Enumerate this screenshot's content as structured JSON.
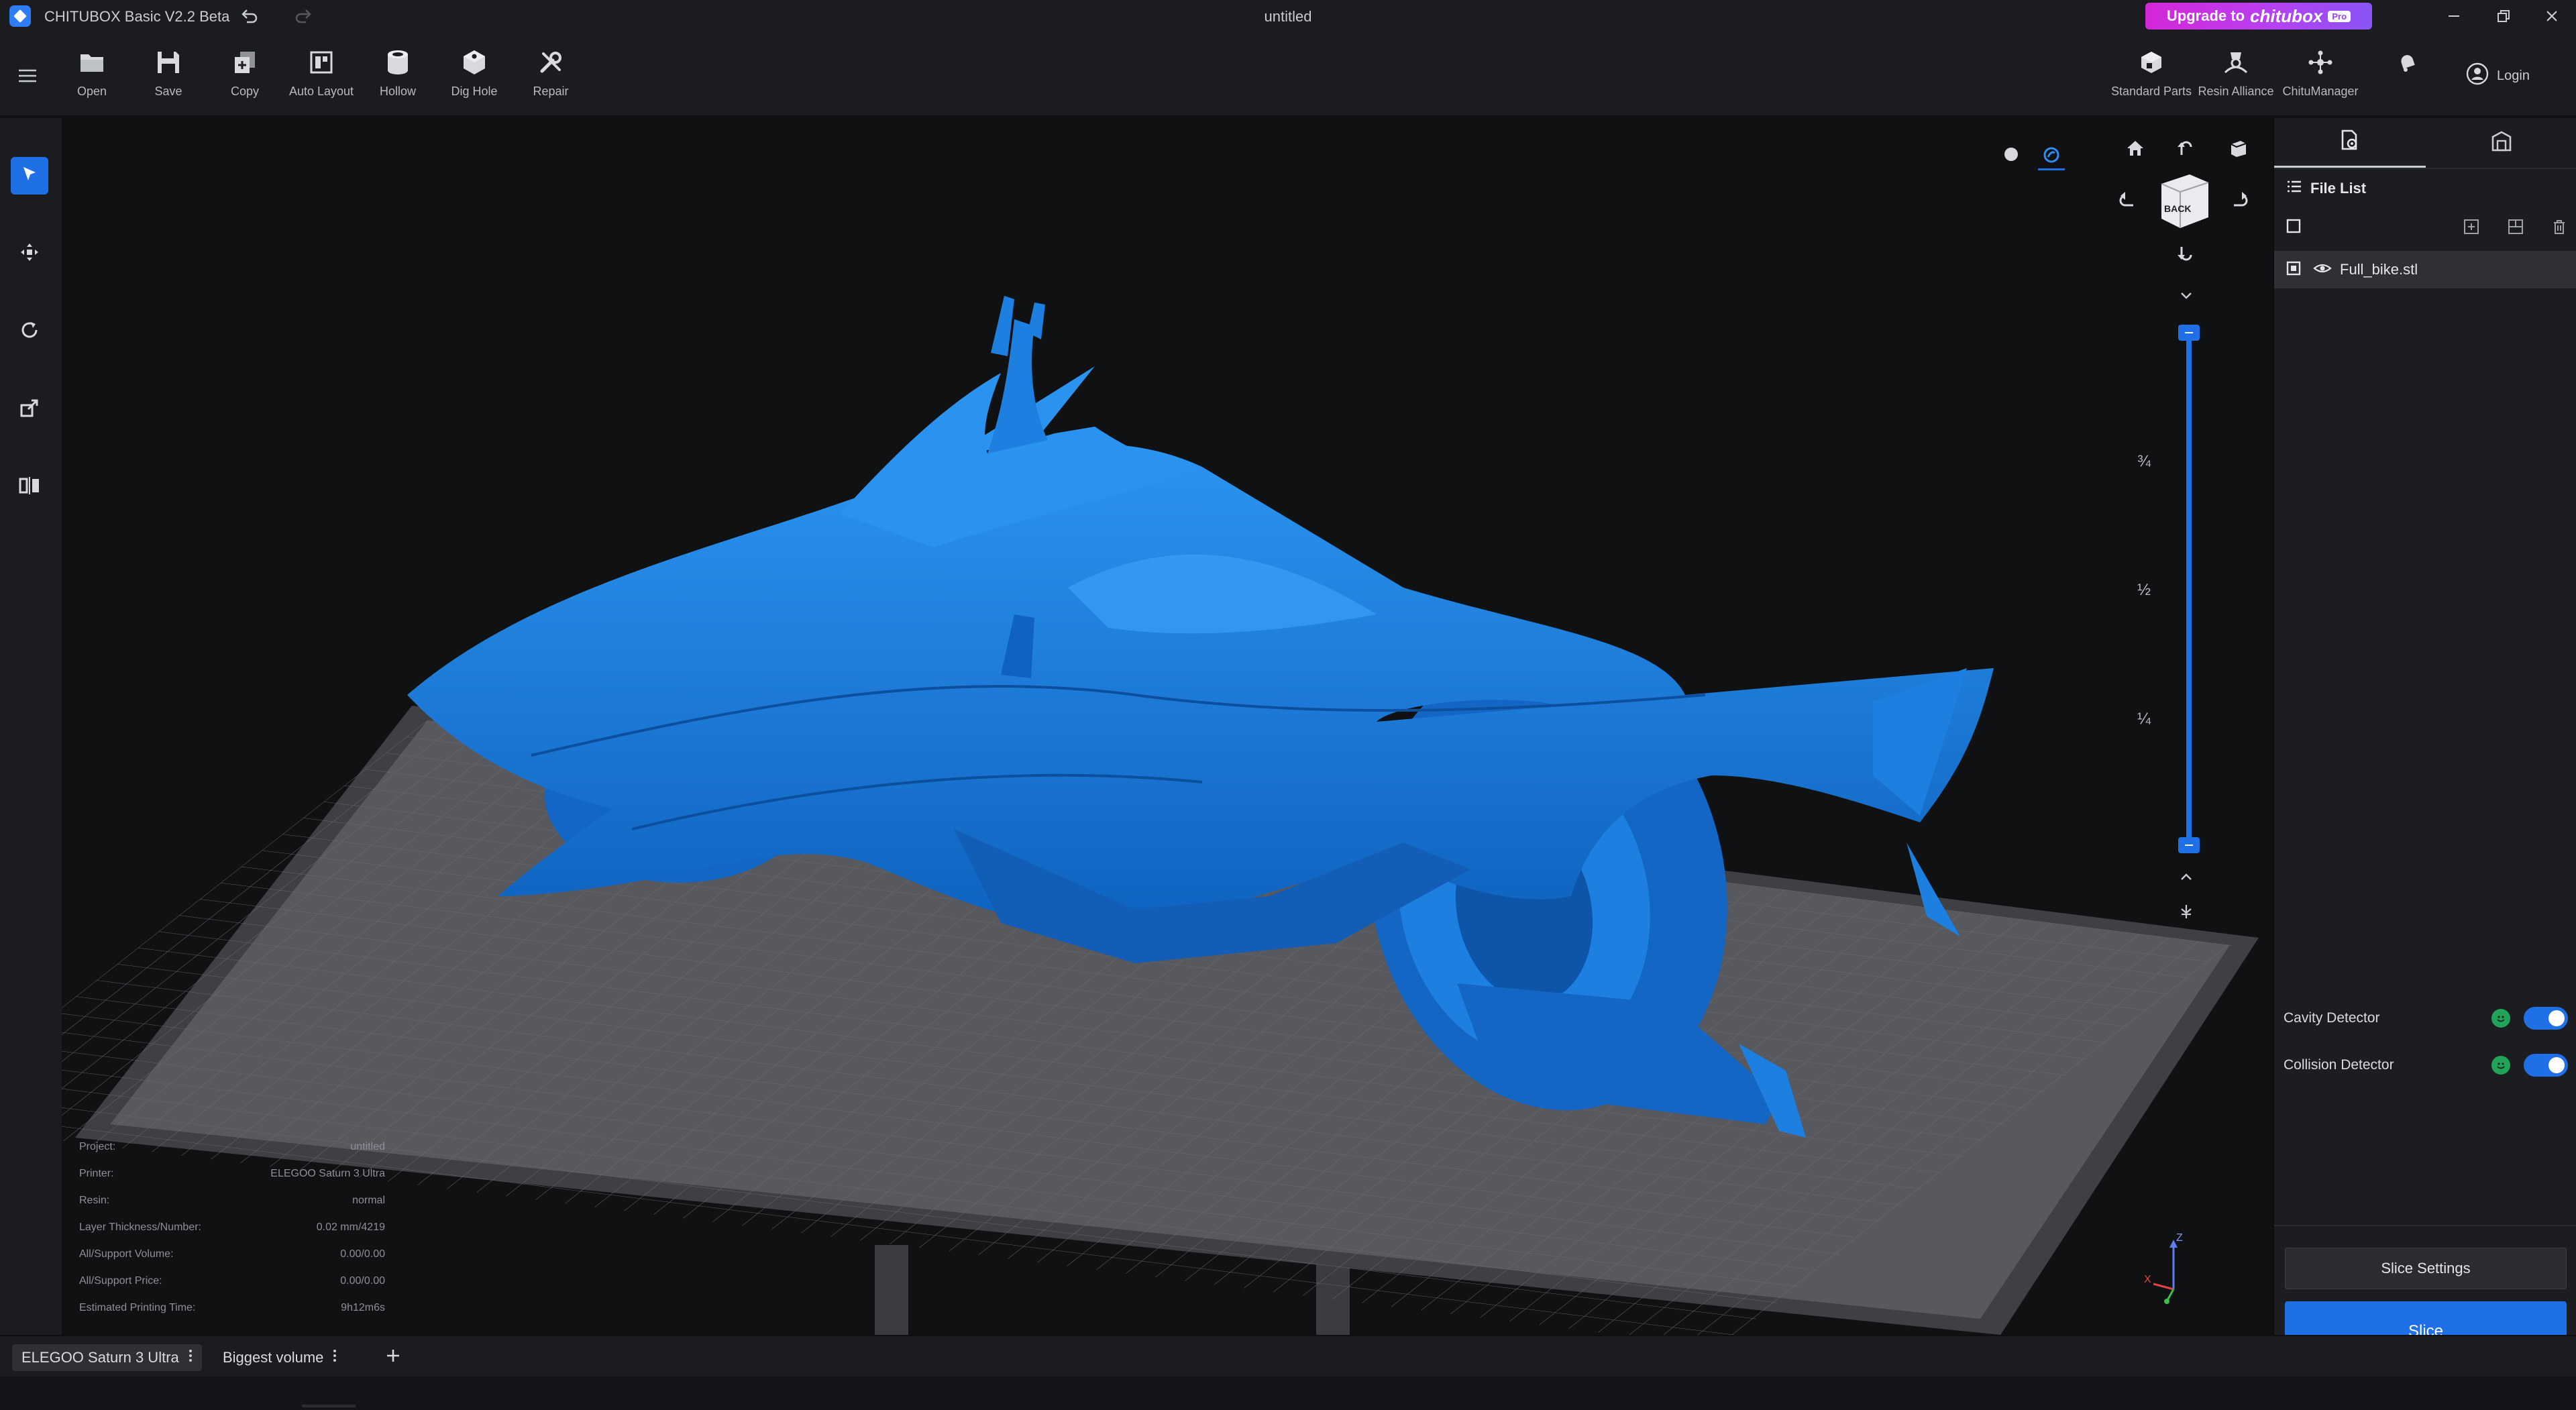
{
  "app": {
    "title": "CHITUBOX Basic V2.2 Beta",
    "document_title": "untitled",
    "upgrade": {
      "prefix": "Upgrade to",
      "brand": "chitubox",
      "badge": "Pro"
    }
  },
  "toolbar": {
    "tools": [
      {
        "name": "open",
        "label": "Open"
      },
      {
        "name": "save",
        "label": "Save"
      },
      {
        "name": "copy",
        "label": "Copy"
      },
      {
        "name": "auto-layout",
        "label": "Auto Layout"
      },
      {
        "name": "hollow",
        "label": "Hollow"
      },
      {
        "name": "dig-hole",
        "label": "Dig Hole"
      },
      {
        "name": "repair",
        "label": "Repair"
      }
    ],
    "right_tools": [
      {
        "name": "standard-parts",
        "label": "Standard Parts"
      },
      {
        "name": "resin-alliance",
        "label": "Resin Alliance"
      },
      {
        "name": "chitumanager",
        "label": "ChituManager"
      }
    ],
    "login_label": "Login"
  },
  "left_toolbar": {
    "items": [
      "select-icon",
      "move-icon",
      "rotate-icon",
      "scale-icon",
      "mirror-icon"
    ],
    "active": "select-icon"
  },
  "view": {
    "cube_face": "BACK",
    "slider_labels": [
      "¾",
      "½",
      "¼"
    ]
  },
  "right_panel": {
    "file_list_title": "File List",
    "files": [
      {
        "name": "Full_bike.stl"
      }
    ],
    "detectors": [
      {
        "label": "Cavity Detector",
        "enabled": true
      },
      {
        "label": "Collision Detector",
        "enabled": true
      }
    ],
    "slice_settings_label": "Slice Settings",
    "slice_label": "Slice"
  },
  "info": {
    "rows": [
      {
        "label": "Project:",
        "value": "untitled"
      },
      {
        "label": "Printer:",
        "value": "ELEGOO Saturn 3 Ultra"
      },
      {
        "label": "Resin:",
        "value": "normal"
      },
      {
        "label": "Layer Thickness/Number:",
        "value": "0.02 mm/4219"
      },
      {
        "label": "All/Support Volume:",
        "value": "0.00/0.00"
      },
      {
        "label": "All/Support Price:",
        "value": "0.00/0.00"
      },
      {
        "label": "Estimated Printing Time:",
        "value": "9h12m6s"
      }
    ]
  },
  "bottom_tabs": [
    {
      "label": "ELEGOO Saturn 3 Ultra",
      "active": true
    },
    {
      "label": "Biggest volume",
      "active": false
    }
  ],
  "colors": {
    "accent": "#1f6fe6",
    "model": "#1d7fe0",
    "upgrade_gradient_start": "#d527d7"
  }
}
